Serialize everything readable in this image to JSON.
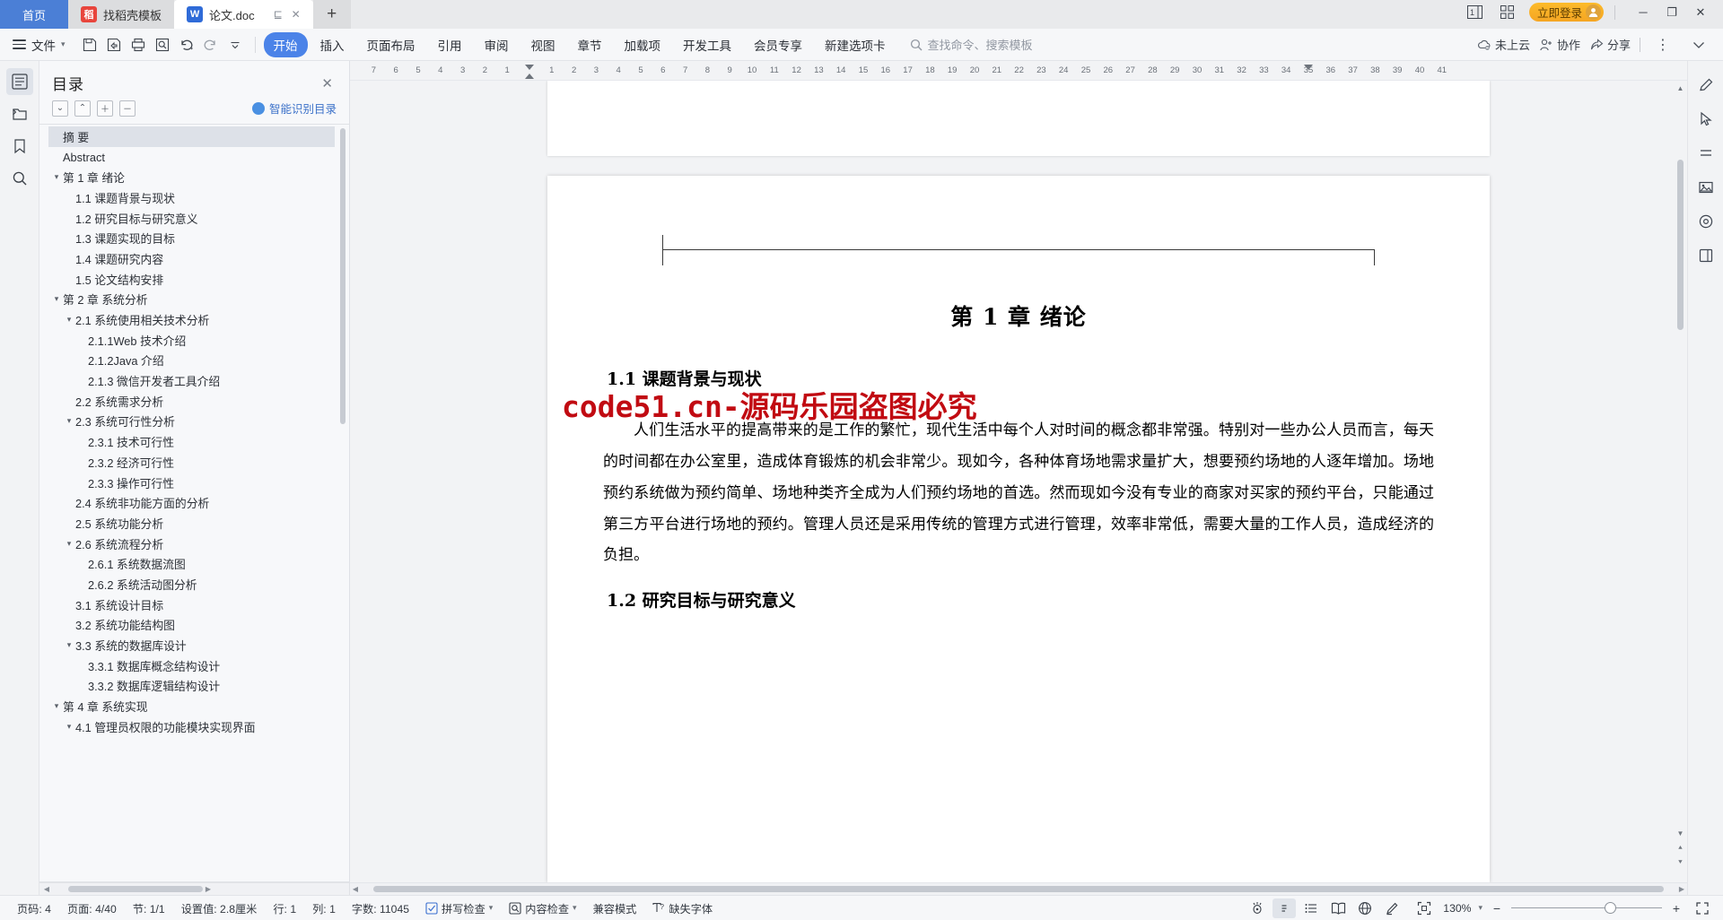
{
  "titlebar": {
    "tabs": [
      {
        "label": "首页",
        "type": "home"
      },
      {
        "label": "找稻壳模板",
        "type": "inactive",
        "icon": "daoke-icon"
      },
      {
        "label": "论文.doc",
        "type": "active",
        "icon": "wps-writer-icon"
      }
    ],
    "tab_actions": {
      "restore": "⊑",
      "close": "✕"
    },
    "new_tab": "+",
    "icons": {
      "layout": "1",
      "grid": "grid-icon"
    },
    "login_label": "立即登录",
    "window": {
      "minimize": "─",
      "maximize": "❐",
      "close": "✕"
    }
  },
  "ribbon": {
    "file_label": "文件",
    "quick_access": [
      "save-icon",
      "save-as-icon",
      "print-icon",
      "print-preview-icon",
      "undo-icon",
      "redo-icon",
      "customize-icon"
    ],
    "tabs": [
      {
        "label": "开始",
        "active": true
      },
      {
        "label": "插入",
        "active": false
      },
      {
        "label": "页面布局",
        "active": false
      },
      {
        "label": "引用",
        "active": false
      },
      {
        "label": "审阅",
        "active": false
      },
      {
        "label": "视图",
        "active": false
      },
      {
        "label": "章节",
        "active": false
      },
      {
        "label": "加载项",
        "active": false
      },
      {
        "label": "开发工具",
        "active": false
      },
      {
        "label": "会员专享",
        "active": false
      },
      {
        "label": "新建选项卡",
        "active": false
      }
    ],
    "search_placeholder": "查找命令、搜索模板",
    "right_items": [
      {
        "label": "未上云",
        "icon": "cloud-off-icon"
      },
      {
        "label": "协作",
        "icon": "collaborate-icon"
      },
      {
        "label": "分享",
        "icon": "share-icon"
      }
    ]
  },
  "left_rail": [
    {
      "name": "toc-icon",
      "active": true
    },
    {
      "name": "folder-nav-icon",
      "active": false
    },
    {
      "name": "bookmark-icon",
      "active": false
    },
    {
      "name": "search-icon",
      "active": false
    }
  ],
  "toc": {
    "title": "目录",
    "tools": [
      "expand-down",
      "collapse-up",
      "plus",
      "minus"
    ],
    "smart_label": "智能识别目录",
    "items": [
      {
        "label": "摘 要",
        "level": 0,
        "twisty": "",
        "selected": true
      },
      {
        "label": "Abstract",
        "level": 0,
        "twisty": ""
      },
      {
        "label": "第 1 章 绪论",
        "level": 0,
        "twisty": "▾"
      },
      {
        "label": "1.1 课题背景与现状",
        "level": 1,
        "twisty": ""
      },
      {
        "label": "1.2 研究目标与研究意义",
        "level": 1,
        "twisty": ""
      },
      {
        "label": "1.3 课题实现的目标",
        "level": 1,
        "twisty": ""
      },
      {
        "label": "1.4 课题研究内容",
        "level": 1,
        "twisty": ""
      },
      {
        "label": "1.5 论文结构安排",
        "level": 1,
        "twisty": ""
      },
      {
        "label": "第 2 章 系统分析",
        "level": 0,
        "twisty": "▾"
      },
      {
        "label": "2.1 系统使用相关技术分析",
        "level": 1,
        "twisty": "▾"
      },
      {
        "label": "2.1.1Web 技术介绍",
        "level": 2,
        "twisty": ""
      },
      {
        "label": "2.1.2Java 介绍",
        "level": 2,
        "twisty": ""
      },
      {
        "label": "2.1.3 微信开发者工具介绍",
        "level": 2,
        "twisty": ""
      },
      {
        "label": "2.2 系统需求分析",
        "level": 1,
        "twisty": ""
      },
      {
        "label": "2.3 系统可行性分析",
        "level": 1,
        "twisty": "▾"
      },
      {
        "label": "2.3.1 技术可行性",
        "level": 2,
        "twisty": ""
      },
      {
        "label": "2.3.2 经济可行性",
        "level": 2,
        "twisty": ""
      },
      {
        "label": "2.3.3 操作可行性",
        "level": 2,
        "twisty": ""
      },
      {
        "label": "2.4 系统非功能方面的分析",
        "level": 1,
        "twisty": ""
      },
      {
        "label": "2.5 系统功能分析",
        "level": 1,
        "twisty": ""
      },
      {
        "label": "2.6 系统流程分析",
        "level": 1,
        "twisty": "▾"
      },
      {
        "label": "2.6.1 系统数据流图",
        "level": 2,
        "twisty": ""
      },
      {
        "label": "2.6.2 系统活动图分析",
        "level": 2,
        "twisty": ""
      },
      {
        "label": "3.1 系统设计目标",
        "level": 1,
        "twisty": ""
      },
      {
        "label": "3.2 系统功能结构图",
        "level": 1,
        "twisty": ""
      },
      {
        "label": "3.3 系统的数据库设计",
        "level": 1,
        "twisty": "▾"
      },
      {
        "label": "3.3.1 数据库概念结构设计",
        "level": 2,
        "twisty": ""
      },
      {
        "label": "3.3.2 数据库逻辑结构设计",
        "level": 2,
        "twisty": ""
      },
      {
        "label": "第 4 章 系统实现",
        "level": 0,
        "twisty": "▾"
      },
      {
        "label": "4.1 管理员权限的功能模块实现界面",
        "level": 1,
        "twisty": "▾"
      }
    ]
  },
  "ruler": {
    "left_numbers": [
      "7",
      "6",
      "5",
      "4",
      "3",
      "2",
      "1"
    ],
    "right_numbers": [
      "1",
      "2",
      "3",
      "4",
      "5",
      "6",
      "7",
      "8",
      "9",
      "10",
      "11",
      "12",
      "13",
      "14",
      "15",
      "16",
      "17",
      "18",
      "19",
      "20",
      "21",
      "22",
      "23",
      "24",
      "25",
      "26",
      "27",
      "28",
      "29",
      "30",
      "31",
      "32",
      "33",
      "34",
      "35",
      "36",
      "37",
      "38",
      "39",
      "40",
      "41"
    ]
  },
  "document": {
    "chapter_title": "第 1 章 绪论",
    "heading_1_1": "1.1 课题背景与现状",
    "watermark": "code51.cn-源码乐园盗图必究",
    "paragraph_1": "人们生活水平的提高带来的是工作的繁忙，现代生活中每个人对时间的概念都非常强。特别对一些办公人员而言，每天的时间都在办公室里，造成体育锻炼的机会非常少。现如今，各种体育场地需求量扩大，想要预约场地的人逐年增加。场地预约系统做为预约简单、场地种类齐全成为人们预约场地的首选。然而现如今没有专业的商家对买家的预约平台，只能通过第三方平台进行场地的预约。管理人员还是采用传统的管理方式进行管理，效率非常低，需要大量的工作人员，造成经济的负担。",
    "heading_1_2": "1.2 研究目标与研究意义"
  },
  "right_rail": [
    {
      "name": "pen-edit-icon"
    },
    {
      "name": "cursor-select-icon"
    },
    {
      "name": "paragraph-mark-icon"
    },
    {
      "name": "image-insert-icon"
    },
    {
      "name": "shapes-icon"
    },
    {
      "name": "page-layout-icon"
    }
  ],
  "statusbar": {
    "items": [
      {
        "label": "页码: 4",
        "name": "page-number"
      },
      {
        "label": "页面: 4/40",
        "name": "page-count"
      },
      {
        "label": "节: 1/1",
        "name": "section"
      },
      {
        "label": "设置值: 2.8厘米",
        "name": "setting-value"
      },
      {
        "label": "行: 1",
        "name": "line"
      },
      {
        "label": "列: 1",
        "name": "column"
      },
      {
        "label": "字数: 11045",
        "name": "word-count"
      }
    ],
    "checks": [
      {
        "label": "拼写检查",
        "icon": "spellcheck-icon",
        "caret": "▾"
      },
      {
        "label": "内容检查",
        "icon": "contentcheck-icon",
        "caret": "▾"
      }
    ],
    "compat_label": "兼容模式",
    "missing_font_label": "缺失字体",
    "view_icons": [
      "focus-mode-icon",
      "page-view-icon",
      "outline-view-icon",
      "reading-view-icon",
      "web-view-icon",
      "writing-mode-icon"
    ],
    "zoom": {
      "fit_icon": "fit-page-icon",
      "value": "130%",
      "caret": "▾",
      "minus": "−",
      "plus": "+",
      "fullscreen_icon": "fullscreen-icon"
    }
  },
  "colors": {
    "accent_blue": "#4b83e8",
    "home_tab_blue": "#4b7fd6",
    "login_orange": "#f5a623",
    "watermark_red": "#c10b12"
  }
}
